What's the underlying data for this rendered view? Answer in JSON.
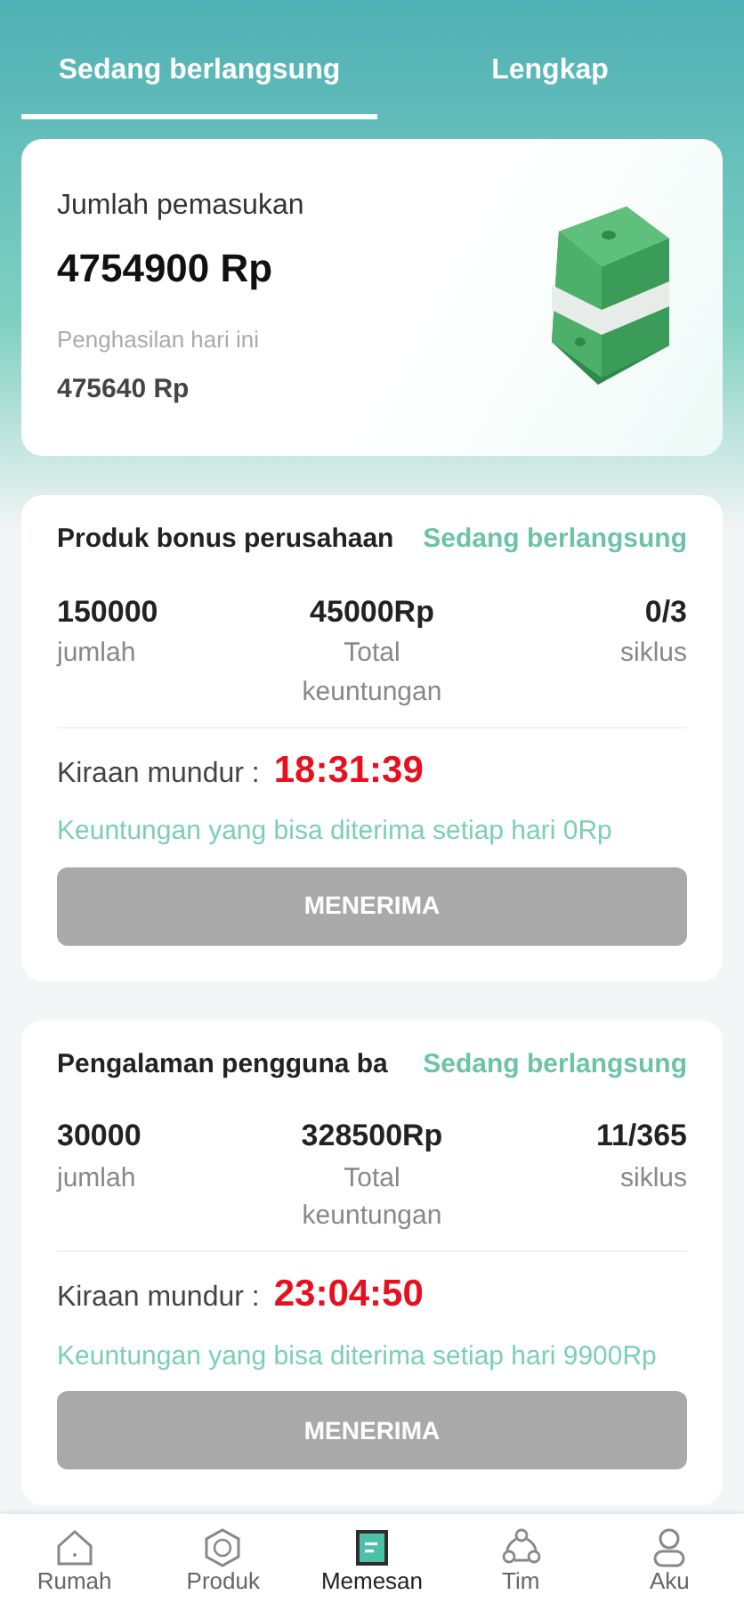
{
  "tabs": [
    {
      "label": "Sedang berlangsung",
      "selected": true
    },
    {
      "label": "Lengkap",
      "selected": false
    }
  ],
  "summary": {
    "title": "Jumlah pemasukan",
    "total": "4754900 Rp",
    "today_label": "Penghasilan hari ini",
    "today": "475640 Rp"
  },
  "orders": [
    {
      "title": "Produk bonus perusahaan",
      "status": "Sedang berlangsung",
      "amount": "150000",
      "amount_label": "jumlah",
      "profit": "45000Rp",
      "profit_label": "Total keuntungan",
      "cycle": "0/3",
      "cycle_label": "siklus",
      "countdown_label": "Kiraan mundur :",
      "countdown": "18:31:39",
      "daily": "Keuntungan yang bisa diterima setiap hari 0Rp",
      "button": "MENERIMA",
      "disabled": true
    },
    {
      "title": "Pengalaman pengguna ba",
      "status": "Sedang berlangsung",
      "amount": "30000",
      "amount_label": "jumlah",
      "profit": "328500Rp",
      "profit_label": "Total keuntungan",
      "cycle": "11/365",
      "cycle_label": "siklus",
      "countdown_label": "Kiraan mundur :",
      "countdown": "23:04:50",
      "daily": "Keuntungan yang bisa diterima setiap hari 9900Rp",
      "button": "MENERIMA",
      "disabled": true
    }
  ],
  "bottom_nav": [
    {
      "label": "Rumah",
      "kind": "home",
      "selected": false
    },
    {
      "label": "Produk",
      "kind": "product",
      "selected": false
    },
    {
      "label": "Memesan",
      "kind": "orders",
      "selected": true
    },
    {
      "label": "Tim",
      "kind": "team",
      "selected": false
    },
    {
      "label": "Aku",
      "kind": "me",
      "selected": false
    }
  ]
}
